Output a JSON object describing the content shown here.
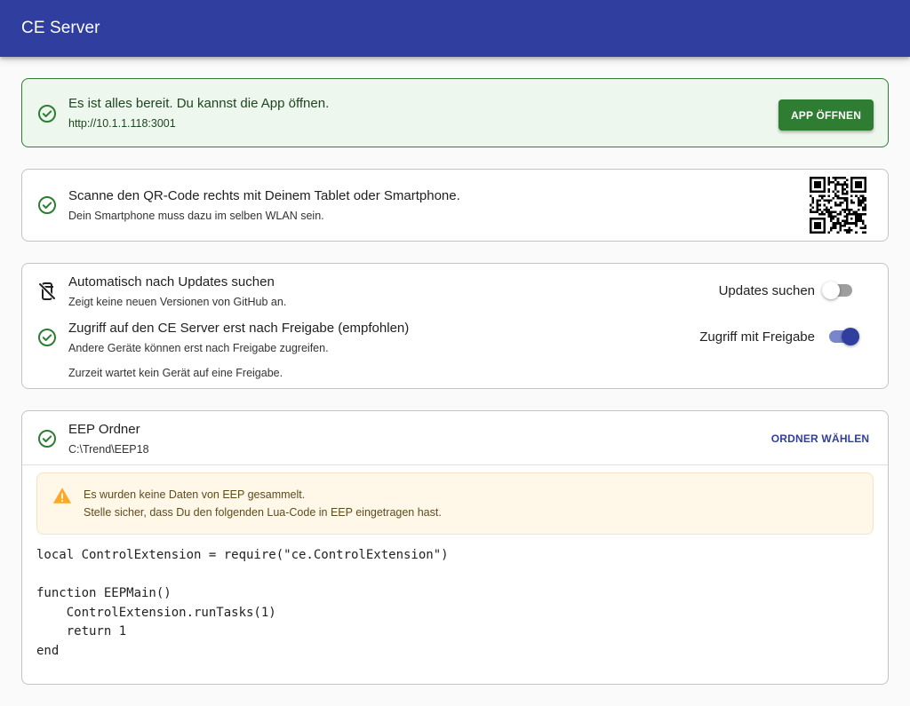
{
  "app": {
    "title": "CE Server"
  },
  "ready": {
    "message": "Es ist alles bereit. Du kannst die App öffnen.",
    "url": "http://10.1.1.118:3001",
    "open_button": "APP ÖFFNEN",
    "icon": "check-circle-icon"
  },
  "qr": {
    "title": "Scanne den QR-Code rechts mit Deinem Tablet oder Smartphone.",
    "hint": "Dein Smartphone muss dazu im selben WLAN sein.",
    "icon": "check-circle-icon"
  },
  "settings": {
    "updates": {
      "title": "Automatisch nach Updates suchen",
      "description": "Zeigt keine neuen Versionen von GitHub an.",
      "switch_label": "Updates suchen",
      "enabled": false,
      "icon": "mobile-off-icon"
    },
    "access": {
      "title": "Zugriff auf den CE Server erst nach Freigabe (empfohlen)",
      "description": "Andere Geräte können erst nach Freigabe zugreifen.",
      "switch_label": "Zugriff mit Freigabe",
      "enabled": true,
      "icon": "check-circle-icon"
    },
    "waiting_status": "Zurzeit wartet kein Gerät auf eine Freigabe."
  },
  "eep": {
    "title": "EEP Ordner",
    "path": "C:\\Trend\\EEP18",
    "choose_button": "ORDNER WÄHLEN",
    "icon": "check-circle-icon",
    "warning": {
      "line1": "Es wurden keine Daten von EEP gesammelt.",
      "line2": "Stelle sicher, dass Du den folgenden Lua-Code in EEP eingetragen hast.",
      "icon": "warning-icon"
    },
    "code": "local ControlExtension = require(\"ce.ControlExtension\")\n\nfunction EEPMain()\n    ControlExtension.runTasks(1)\n    return 1\nend"
  },
  "colors": {
    "primary": "#303f9f",
    "success": "#2e7d32",
    "success_bg": "#edf7ed",
    "warning": "#ffa726",
    "warning_bg": "#fff8e9"
  }
}
